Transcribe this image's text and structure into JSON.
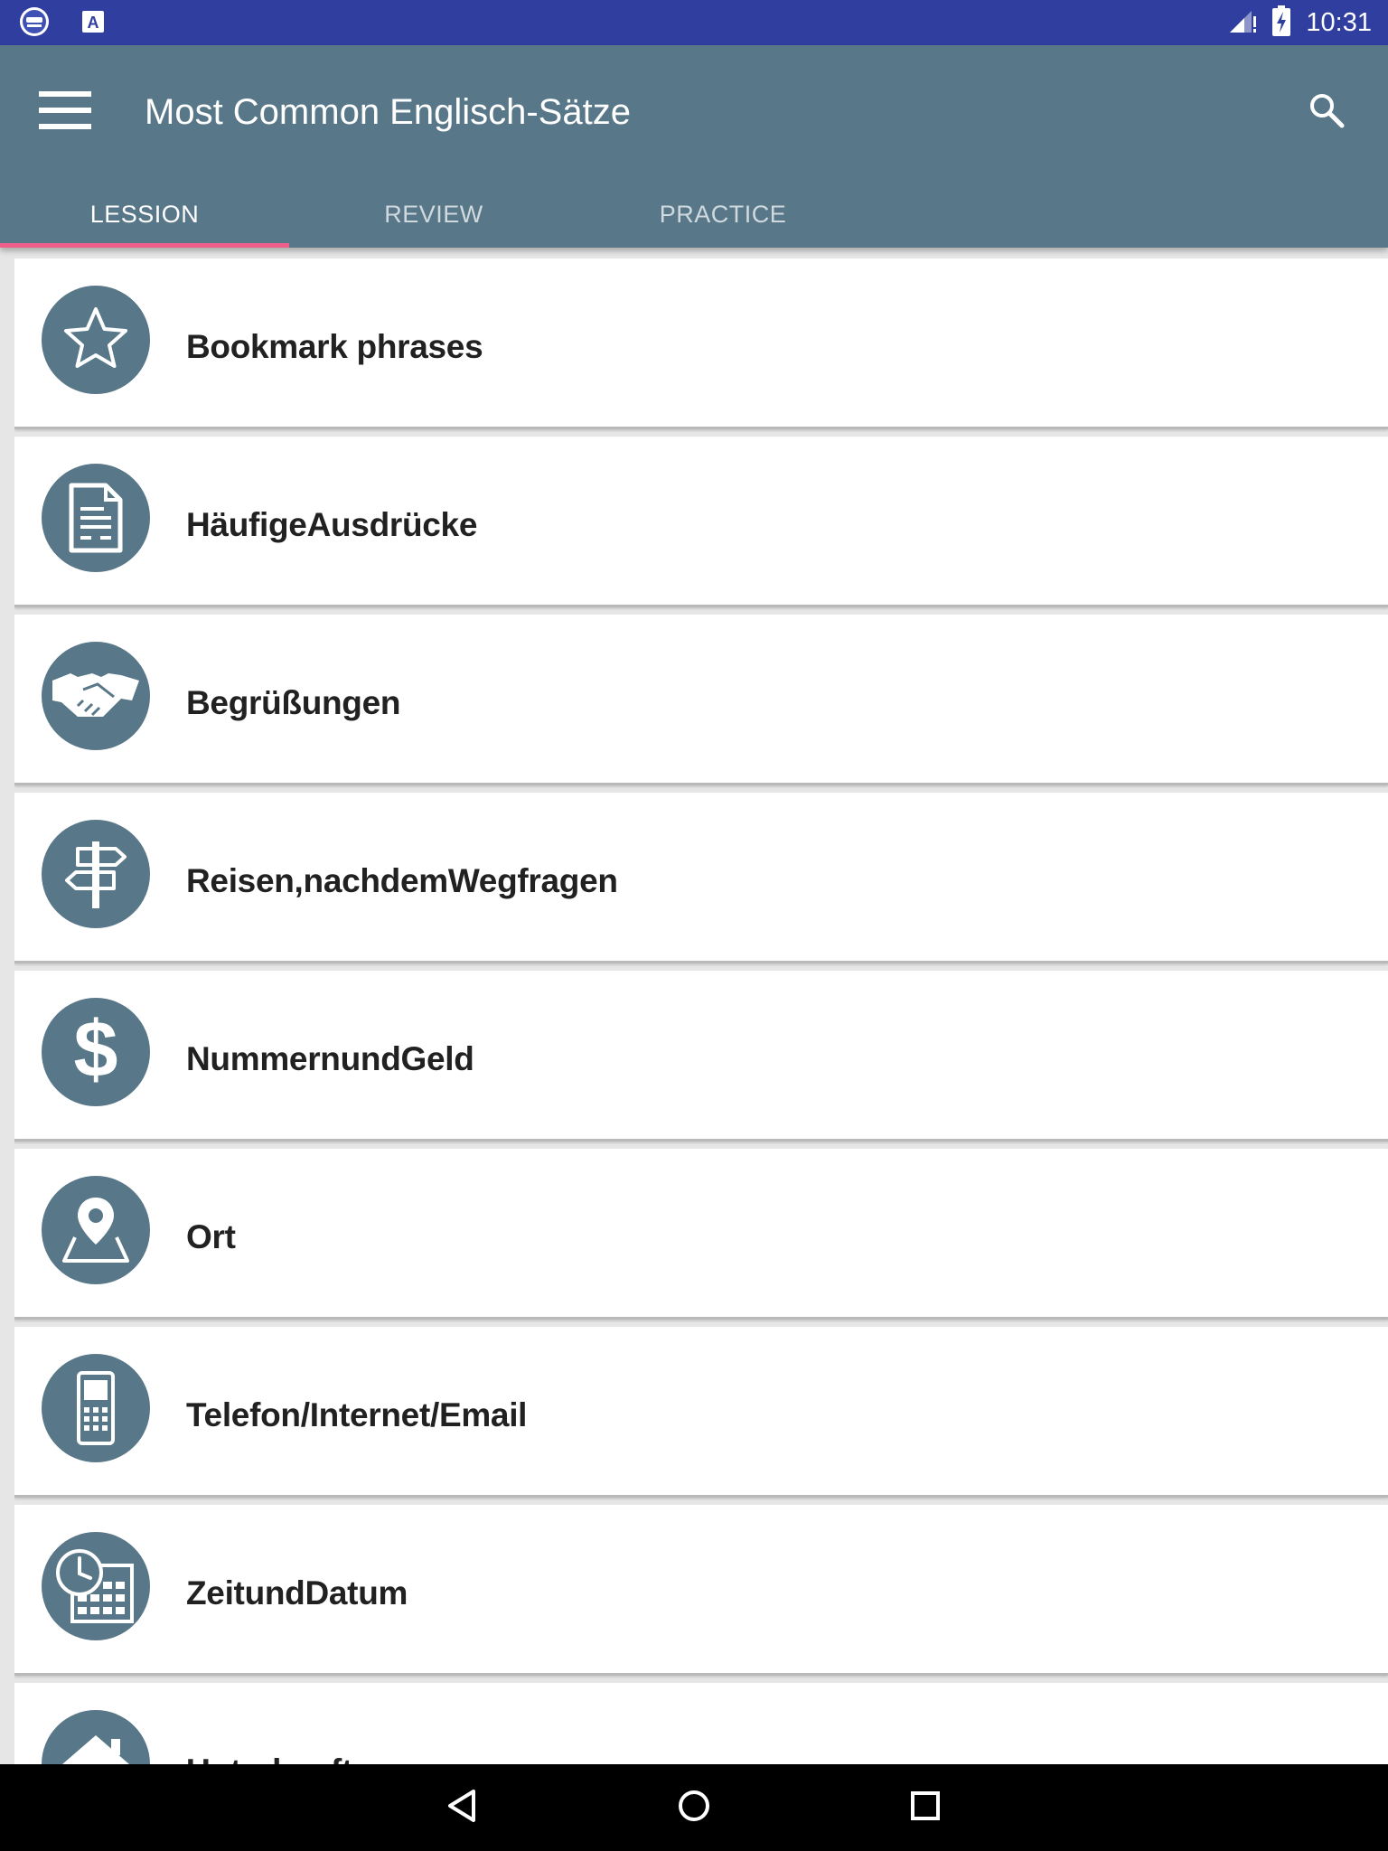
{
  "status_bar": {
    "time": "10:31",
    "notification_icons": [
      "app-logo-icon",
      "text-a-icon"
    ],
    "system_icons": [
      "signal-icon",
      "battery-charging-icon"
    ]
  },
  "app_bar": {
    "title": "Most Common Englisch-Sätze",
    "menu_icon": "hamburger-menu-icon",
    "search_icon": "search-icon",
    "background_color": "#587788"
  },
  "tabs": [
    {
      "label": "LESSION",
      "active": true
    },
    {
      "label": "REVIEW",
      "active": false
    },
    {
      "label": "PRACTICE",
      "active": false
    }
  ],
  "tab_indicator_color": "#ef5f8c",
  "lessons": [
    {
      "label": "Bookmark phrases",
      "icon": "star-icon"
    },
    {
      "label": "HäufigeAusdrücke",
      "icon": "document-icon"
    },
    {
      "label": "Begrüßungen",
      "icon": "handshake-icon"
    },
    {
      "label": "Reisen,nachdemWegfragen",
      "icon": "signpost-icon"
    },
    {
      "label": "NummernundGeld",
      "icon": "dollar-icon"
    },
    {
      "label": "Ort",
      "icon": "map-pin-icon"
    },
    {
      "label": "Telefon/Internet/Email",
      "icon": "mobile-phone-icon"
    },
    {
      "label": "ZeitundDatum",
      "icon": "clock-calendar-icon"
    },
    {
      "label": "Unterkunft",
      "icon": "house-icon"
    }
  ],
  "nav_bar": {
    "buttons": [
      "back-icon",
      "home-icon",
      "recents-icon"
    ]
  }
}
